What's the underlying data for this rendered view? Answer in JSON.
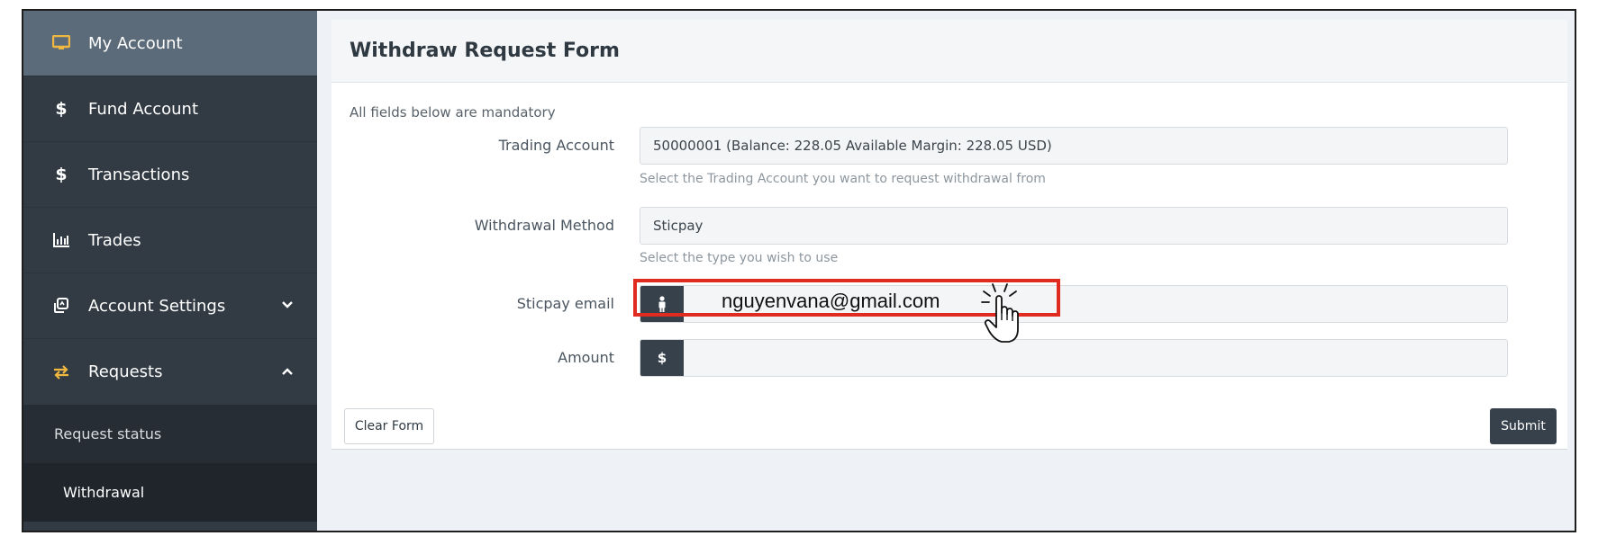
{
  "sidebar": {
    "items": [
      {
        "label": "My Account",
        "icon": "monitor-icon",
        "active": true
      },
      {
        "label": "Fund Account",
        "icon": "dollar-icon"
      },
      {
        "label": "Transactions",
        "icon": "dollar-icon"
      },
      {
        "label": "Trades",
        "icon": "bar-chart-icon"
      },
      {
        "label": "Account Settings",
        "icon": "copy-settings-icon",
        "chevron": "chevron-down-icon"
      },
      {
        "label": "Requests",
        "icon": "swap-arrows-icon",
        "chevron": "chevron-up-icon"
      }
    ],
    "sub_items": [
      {
        "label": "Request status"
      },
      {
        "label": "Withdrawal",
        "current": true
      }
    ],
    "dollar_glyph": "$"
  },
  "form": {
    "title": "Withdraw Request Form",
    "mandatory_note": "All fields below are mandatory",
    "trading_account": {
      "label": "Trading Account",
      "value": "50000001 (Balance: 228.05 Available Margin: 228.05 USD)",
      "help": "Select the Trading Account you want to request withdrawal from"
    },
    "withdrawal_method": {
      "label": "Withdrawal Method",
      "value": "Sticpay",
      "help": "Select the type you wish to use"
    },
    "sticpay_email": {
      "label": "Sticpay email",
      "value": "nguyenvana@gmail.com",
      "addon_icon": "person-icon"
    },
    "amount": {
      "label": "Amount",
      "addon": "$",
      "value": ""
    },
    "clear_label": "Clear Form",
    "submit_label": "Submit"
  },
  "colors": {
    "sidebar_bg": "#323b44",
    "sidebar_active": "#5c6b79",
    "addon_bg": "#36414b",
    "highlight": "#e02b20"
  }
}
